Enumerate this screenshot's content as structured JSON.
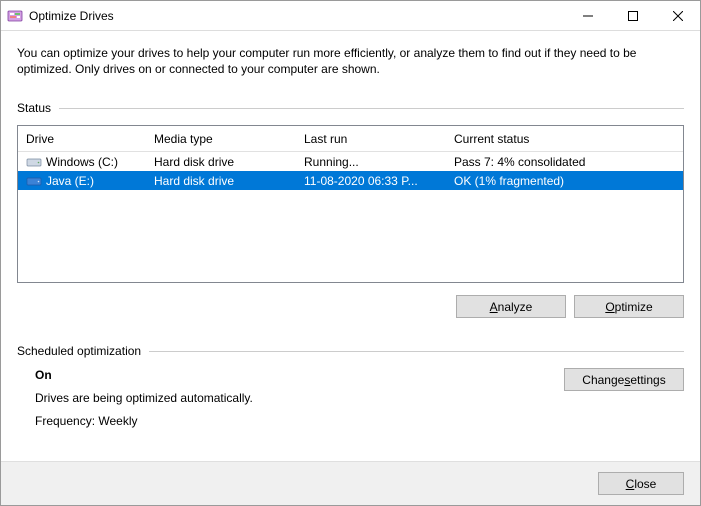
{
  "window": {
    "title": "Optimize Drives"
  },
  "intro": "You can optimize your drives to help your computer run more efficiently, or analyze them to find out if they need to be optimized. Only drives on or connected to your computer are shown.",
  "status": {
    "label": "Status",
    "columns": {
      "drive": "Drive",
      "media": "Media type",
      "lastrun": "Last run",
      "current": "Current status"
    },
    "rows": [
      {
        "drive": "Windows (C:)",
        "media": "Hard disk drive",
        "lastrun": "Running...",
        "current": "Pass 7: 4% consolidated",
        "selected": false,
        "icon": "disk-c"
      },
      {
        "drive": "Java (E:)",
        "media": "Hard disk drive",
        "lastrun": "11-08-2020 06:33 P...",
        "current": "OK (1% fragmented)",
        "selected": true,
        "icon": "disk-e"
      }
    ],
    "buttons": {
      "analyze_pre": "",
      "analyze_u": "A",
      "analyze_post": "nalyze",
      "optimize_pre": "",
      "optimize_u": "O",
      "optimize_post": "ptimize"
    }
  },
  "scheduled": {
    "label": "Scheduled optimization",
    "on": "On",
    "desc": "Drives are being optimized automatically.",
    "freq": "Frequency: Weekly",
    "change_pre": "Change ",
    "change_u": "s",
    "change_post": "ettings"
  },
  "footer": {
    "close_pre": "",
    "close_u": "C",
    "close_post": "lose"
  }
}
